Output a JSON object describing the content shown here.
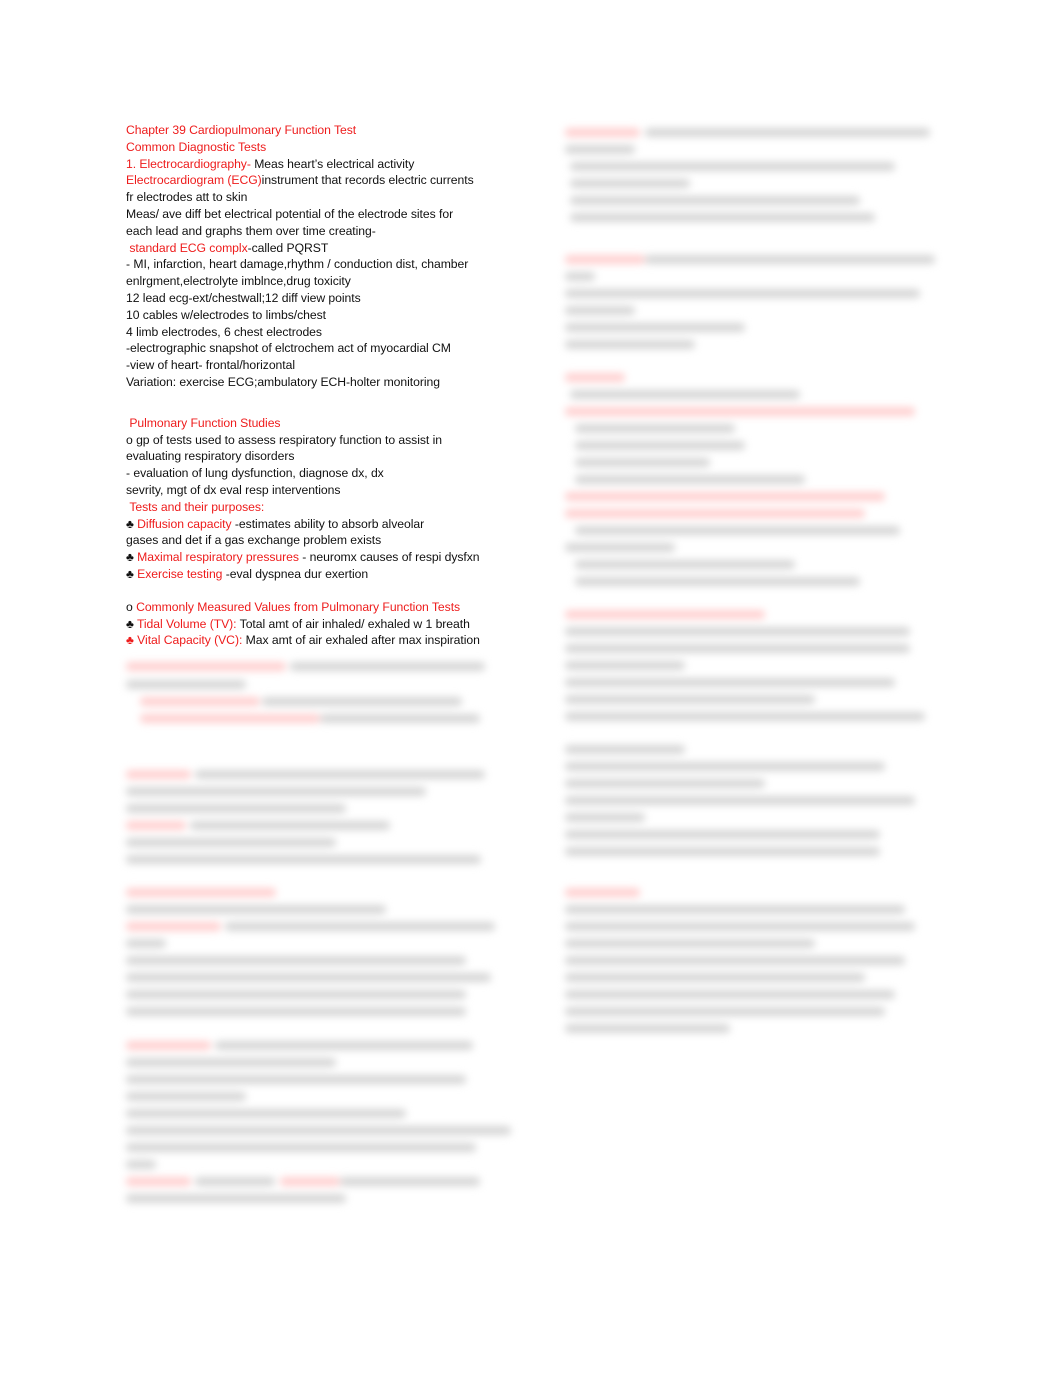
{
  "document": {
    "title": "Chapter 39 Cardiopulmonary Function Test",
    "subtitle": "Common Diagnostic Tests",
    "ecg_section": {
      "heading_prefix": "1. Electrocardiography-",
      "heading_text": " Meas heart’s electrical activity",
      "ecg_term": "Electrocardiogram (ECG)",
      "ecg_def": "instrument that records electric currents",
      "lines": [
        "fr electrodes att to skin",
        "Meas/ ave diff bet electrical potential of the electrode sites for",
        "each lead and graphs them over time creating-"
      ],
      "complex_term": "standard ECG complx",
      "complex_def": "-called PQRST",
      "details": [
        "- MI, infarction, heart damage,rhythm / conduction dist, chamber",
        "enlrgment,electrolyte imblnce,drug toxicity",
        "12 lead ecg-ext/chestwall;12 diff view points",
        "10 cables w/electrodes to limbs/chest",
        "4 limb electrodes, 6 chest electrodes",
        "-electrographic snapshot of elctrochem act of myocardial CM",
        "-view of heart- frontal/horizontal",
        "Variation: exercise ECG;ambulatory ECH-holter monitoring"
      ]
    },
    "pft_section": {
      "heading": "Pulmonary Function Studies",
      "lines": [
        "o gp of tests used to assess respiratory function to assist in",
        "evaluating respiratory disorders",
        "- evaluation of lung dysfunction, diagnose dx, dx",
        "sevrity, mgt of dx eval resp interventions"
      ],
      "tests_heading": "Tests and their purposes:",
      "tests": [
        {
          "icon": "♣",
          "term": "Diffusion capacity",
          "desc": " -estimates ability to absorb alveolar",
          "cont": "gases and det if a gas exchange problem exists"
        },
        {
          "icon": "♣",
          "term": "Maximal respiratory pressures",
          "desc": " - neuromx causes of respi dysfxn"
        },
        {
          "icon": "♣",
          "term": "Exercise testing",
          "desc": " -eval dyspnea dur exertion"
        }
      ],
      "values_prefix": "o ",
      "values_heading": "Commonly Measured Values from Pulmonary Function Tests",
      "values": [
        {
          "icon": "♣",
          "term": "Tidal Volume (TV):",
          "desc": " Total amt of air inhaled/ exhaled w 1 breath"
        },
        {
          "icon": "♣",
          "term": "Vital Capacity (VC):",
          "desc": " Max amt of air exhaled after max inspiration"
        }
      ]
    }
  },
  "colors": {
    "accent_red": "#ee1c1c",
    "text": "#111111"
  }
}
